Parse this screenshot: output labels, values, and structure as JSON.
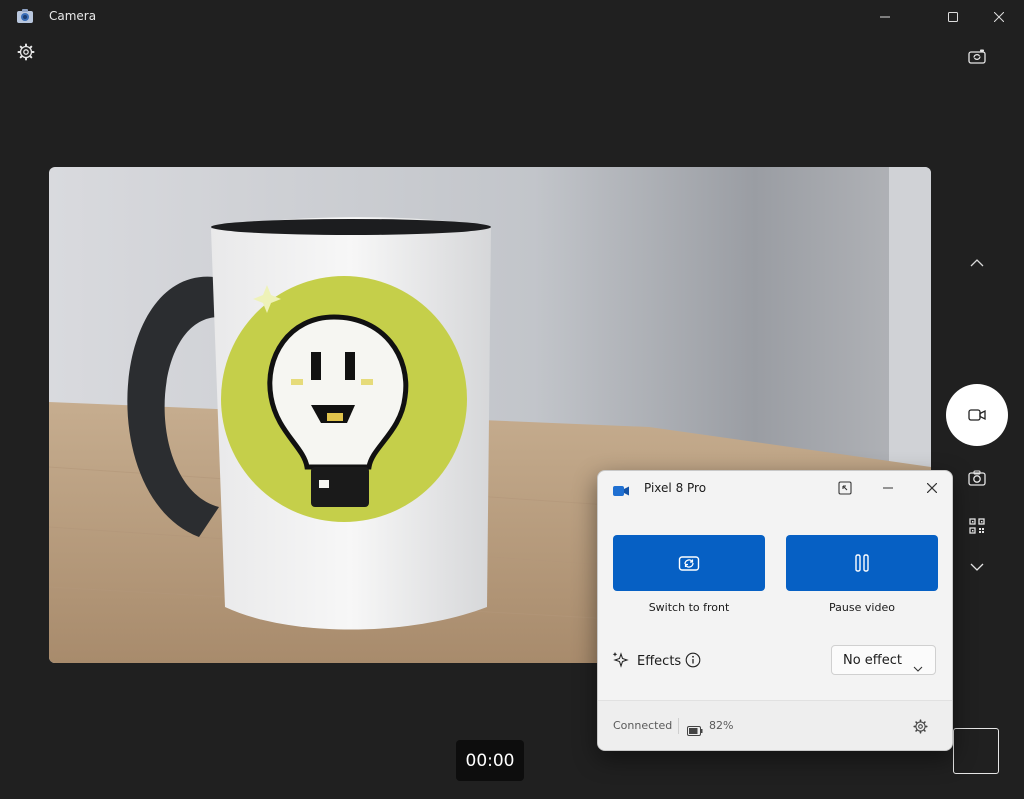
{
  "app": {
    "title": "Camera",
    "icons": {
      "app": "camera-app-icon",
      "settings": "gear-icon",
      "switch_camera": "camera-switch-icon",
      "chevron_up": "chevron-up-icon",
      "video_mode": "video-camera-icon",
      "photo_mode": "camera-icon",
      "qr_mode": "qr-code-icon",
      "chevron_down": "chevron-down-icon"
    }
  },
  "recording": {
    "timer": "00:00"
  },
  "phone_panel": {
    "title": "Pixel 8 Pro",
    "switch_button_label": "Switch to front",
    "pause_button_label": "Pause video",
    "effects_label": "Effects",
    "effects_value": "No effect",
    "status": "Connected",
    "battery": "82%",
    "accent_color": "#0660c4"
  }
}
